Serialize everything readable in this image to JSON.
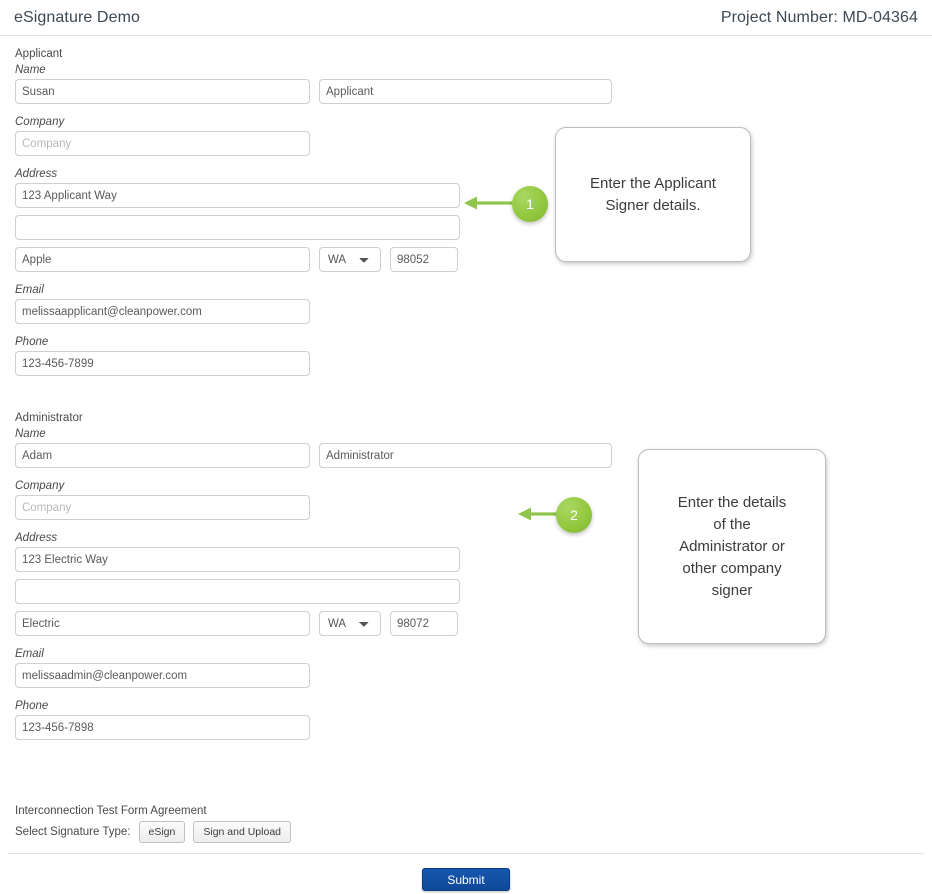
{
  "header": {
    "title": "eSignature Demo",
    "project_number": "Project Number: MD-04364"
  },
  "sections": [
    {
      "key": "applicant",
      "title": "Applicant",
      "labels": {
        "name": "Name",
        "company": "Company",
        "address": "Address",
        "email": "Email",
        "phone": "Phone"
      },
      "fields": {
        "first_name": "Susan",
        "last_name": "Applicant",
        "company": "",
        "company_placeholder": "Company",
        "address1": "123 Applicant Way",
        "address2": "",
        "city": "Apple",
        "state": "WA",
        "zip": "98052",
        "email": "melissaapplicant@cleanpower.com",
        "phone": "123-456-7899"
      }
    },
    {
      "key": "administrator",
      "title": "Administrator",
      "labels": {
        "name": "Name",
        "company": "Company",
        "address": "Address",
        "email": "Email",
        "phone": "Phone"
      },
      "fields": {
        "first_name": "Adam",
        "last_name": "Administrator",
        "company": "",
        "company_placeholder": "Company",
        "address1": "123 Electric Way",
        "address2": "",
        "city": "Electric",
        "state": "WA",
        "zip": "98072",
        "email": "melissaadmin@cleanpower.com",
        "phone": "123-456-7898"
      }
    }
  ],
  "callouts": [
    {
      "number": "1",
      "text": "Enter the Applicant\nSigner details."
    },
    {
      "number": "2",
      "text": "Enter the details\nof the\nAdministrator or\nother company\nsigner"
    }
  ],
  "signature": {
    "agreement": "Interconnection Test Form Agreement",
    "select_label": "Select Signature Type:",
    "esign_button": "eSign",
    "upload_button": "Sign and Upload"
  },
  "footer": {
    "submit_label": "Submit"
  },
  "colors": {
    "badge_green": "#93c83f",
    "arrow_green": "#8fc54a",
    "submit_blue": "#10489a",
    "divider": "#e2e2e2"
  }
}
